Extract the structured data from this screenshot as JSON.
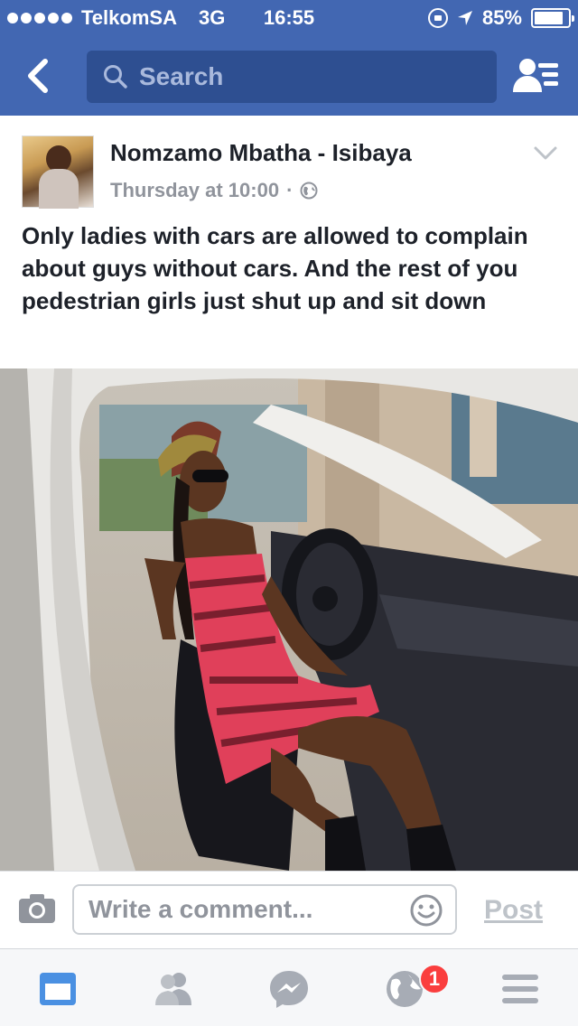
{
  "status_bar": {
    "carrier": "TelkomSA",
    "network": "3G",
    "time": "16:55",
    "battery_percent": "85%",
    "battery_level": 0.85
  },
  "nav": {
    "search_placeholder": "Search"
  },
  "post": {
    "author": "Nomzamo Mbatha - Isibaya",
    "timestamp": "Thursday at 10:00",
    "separator": "·",
    "text": "Only ladies with cars are allowed to complain about guys without cars. And the rest of you pedestrian girls just shut up and sit down"
  },
  "comment_bar": {
    "placeholder": "Write a comment...",
    "post_label": "Post"
  },
  "tab_bar": {
    "notifications_badge": "1"
  },
  "colors": {
    "brand": "#4267b2",
    "badge": "#fa3e3e",
    "tab_active": "#4a90e2"
  }
}
